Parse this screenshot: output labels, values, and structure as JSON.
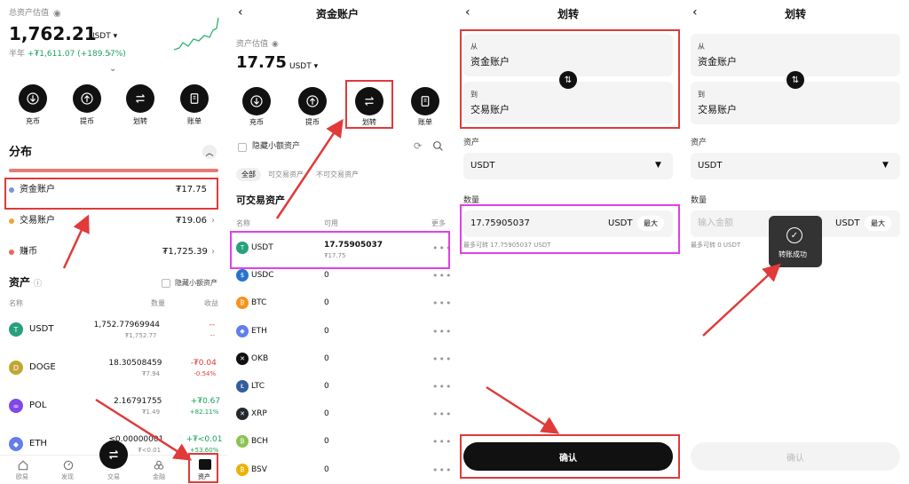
{
  "p1": {
    "title": "总资产估值",
    "total": "1,762.21",
    "currency": "USDT",
    "period_label": "半年",
    "period_change": "+₮1,611.07 (+189.57%)",
    "actions": [
      "充币",
      "提币",
      "划转",
      "账单"
    ],
    "dist_title": "分布",
    "dist": [
      {
        "name": "资金账户",
        "value": "₮17.75",
        "color": "#7b8fe8"
      },
      {
        "name": "交易账户",
        "value": "₮19.06",
        "color": "#f0a23a"
      },
      {
        "name": "赚币",
        "value": "₮1,725.39",
        "color": "#e86a5c"
      }
    ],
    "assets_title": "资产",
    "hide_small": "隐藏小额资产",
    "col_name": "名称",
    "col_qty": "数量",
    "col_profit": "收益",
    "assets": [
      {
        "name": "USDT",
        "qty": "1,752.77969944",
        "sub": "₮1,752.77",
        "p1": "--",
        "p2": "--",
        "color": "#26a17b",
        "glyph": "T"
      },
      {
        "name": "DOGE",
        "qty": "18.30508459",
        "sub": "₮7.94",
        "p1": "-₮0.04",
        "p2": "-0.54%",
        "color": "#c2a633",
        "glyph": "D"
      },
      {
        "name": "POL",
        "qty": "2.16791755",
        "sub": "₮1.49",
        "p1": "+₮0.67",
        "p2": "+82.11%",
        "color": "#8247e5",
        "glyph": "∞"
      },
      {
        "name": "ETH",
        "qty": "≤0.00000001",
        "sub": "₮<0.01",
        "p1": "+₮<0.01",
        "p2": "+53.60%",
        "color": "#627eea",
        "glyph": "◆"
      }
    ],
    "nav": [
      "欧易",
      "发现",
      "交易",
      "金融",
      "资产"
    ]
  },
  "p2": {
    "title": "资金账户",
    "est_label": "资产估值",
    "total": "17.75",
    "currency": "USDT",
    "actions": [
      "充币",
      "提币",
      "划转",
      "账单"
    ],
    "hide_small": "隐藏小额资产",
    "filters": [
      "全部",
      "可交易资产",
      "不可交易资产"
    ],
    "section": "可交易资产",
    "col_name": "名称",
    "col_avail": "可用",
    "col_more": "更多",
    "rows": [
      {
        "name": "USDT",
        "qty": "17.75905037",
        "sub": "₮17.75",
        "color": "#26a17b",
        "glyph": "T"
      },
      {
        "name": "USDC",
        "qty": "0",
        "sub": "",
        "color": "#2775ca",
        "glyph": "$"
      },
      {
        "name": "BTC",
        "qty": "0",
        "sub": "",
        "color": "#f7931a",
        "glyph": "₿"
      },
      {
        "name": "ETH",
        "qty": "0",
        "sub": "",
        "color": "#627eea",
        "glyph": "◆"
      },
      {
        "name": "OKB",
        "qty": "0",
        "sub": "",
        "color": "#111111",
        "glyph": "✕"
      },
      {
        "name": "LTC",
        "qty": "0",
        "sub": "",
        "color": "#345d9d",
        "glyph": "Ł"
      },
      {
        "name": "XRP",
        "qty": "0",
        "sub": "",
        "color": "#23292f",
        "glyph": "✕"
      },
      {
        "name": "BCH",
        "qty": "0",
        "sub": "",
        "color": "#8dc351",
        "glyph": "₿"
      },
      {
        "name": "BSV",
        "qty": "0",
        "sub": "",
        "color": "#eab300",
        "glyph": "₿"
      }
    ]
  },
  "p3": {
    "title": "划转",
    "from_label": "从",
    "from_value": "资金账户",
    "to_label": "到",
    "to_value": "交易账户",
    "asset_label": "资产",
    "asset_value": "USDT",
    "qty_label": "数量",
    "qty_value": "17.75905037",
    "qty_unit": "USDT",
    "max": "最大",
    "max_transfer": "最多可转 17.75905037 USDT",
    "confirm": "确认"
  },
  "p4": {
    "title": "划转",
    "from_label": "从",
    "from_value": "资金账户",
    "to_label": "到",
    "to_value": "交易账户",
    "asset_label": "资产",
    "asset_value": "USDT",
    "qty_label": "数量",
    "qty_placeholder": "输入金额",
    "qty_unit": "USDT",
    "max": "最大",
    "max_transfer": "最多可转 0 USDT",
    "toast": "转账成功",
    "confirm": "确认"
  }
}
